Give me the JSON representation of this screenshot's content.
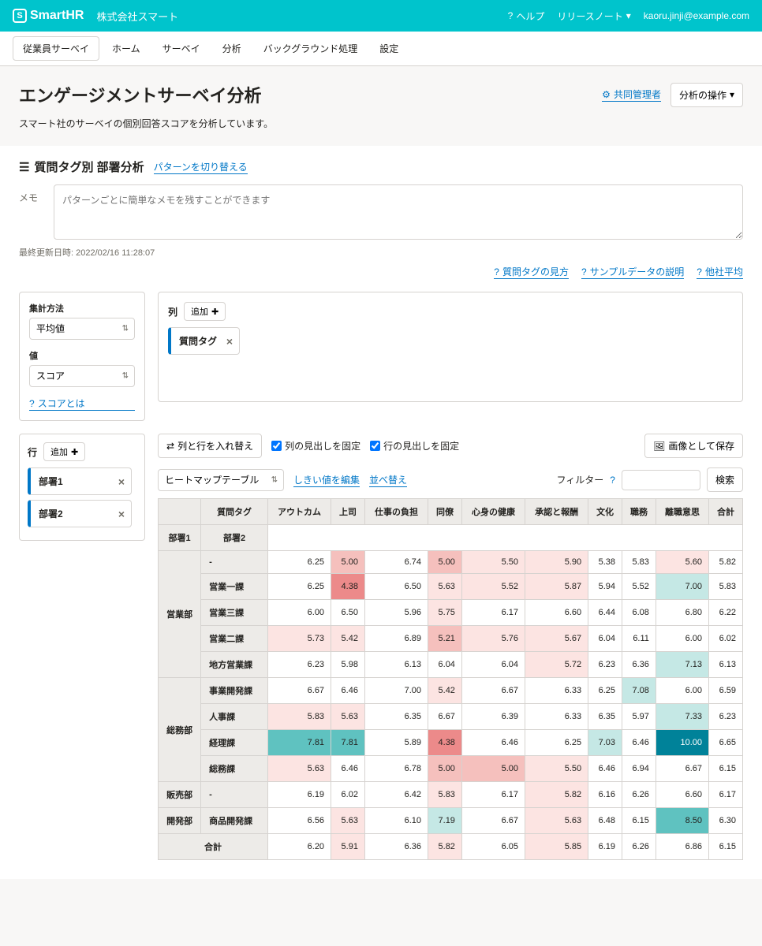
{
  "header": {
    "brand": "SmartHR",
    "company": "株式会社スマート",
    "help": "ヘルプ",
    "release": "リリースノート",
    "user": "kaoru.jinji@example.com"
  },
  "nav": {
    "items": [
      "従業員サーベイ",
      "ホーム",
      "サーベイ",
      "分析",
      "バックグラウンド処理",
      "設定"
    ]
  },
  "page": {
    "title": "エンゲージメントサーベイ分析",
    "desc": "スマート社のサーベイの個別回答スコアを分析しています。",
    "share": "共同管理者",
    "actions": "分析の操作"
  },
  "section": {
    "title": "質問タグ別 部署分析",
    "switch": "パターンを切り替える",
    "memo_label": "メモ",
    "memo_placeholder": "パターンごとに簡単なメモを残すことができます",
    "updated": "最終更新日時: 2022/02/16 11:28:07",
    "help1": "質問タグの見方",
    "help2": "サンプルデータの説明",
    "help3": "他社平均"
  },
  "settings": {
    "agg_label": "集計方法",
    "agg_value": "平均値",
    "val_label": "値",
    "val_value": "スコア",
    "score_link": "スコアとは",
    "col_label": "列",
    "add": "追加",
    "col_chip": "質問タグ",
    "row_label": "行",
    "row_chip1": "部署1",
    "row_chip2": "部署2"
  },
  "toolbar": {
    "swap": "列と行を入れ替え",
    "fix_col": "列の見出しを固定",
    "fix_row": "行の見出しを固定",
    "save_img": "画像として保存",
    "table_type": "ヒートマップテーブル",
    "threshold": "しきい値を編集",
    "sort": "並べ替え",
    "filter": "フィルター",
    "search": "検索"
  },
  "table": {
    "tag_header": "質問タグ",
    "dept1": "部署1",
    "dept2": "部署2",
    "cols": [
      "アウトカム",
      "上司",
      "仕事の負担",
      "同僚",
      "心身の健康",
      "承認と報酬",
      "文化",
      "職務",
      "離職意思",
      "合計"
    ],
    "groups": [
      {
        "dept": "営業部",
        "rows": [
          {
            "sub": "-",
            "v": [
              "6.25",
              "5.00",
              "6.74",
              "5.00",
              "5.50",
              "5.90",
              "5.38",
              "5.83",
              "5.60",
              "5.82"
            ],
            "cls": [
              "",
              "c-pink-m",
              "",
              "c-pink-m",
              "c-pink-l",
              "c-pink-l",
              "",
              "",
              "c-pink-l",
              ""
            ]
          },
          {
            "sub": "営業一課",
            "v": [
              "6.25",
              "4.38",
              "6.50",
              "5.63",
              "5.52",
              "5.87",
              "5.94",
              "5.52",
              "7.00",
              "5.83"
            ],
            "cls": [
              "",
              "c-pink-d",
              "",
              "c-pink-l",
              "c-pink-l",
              "c-pink-l",
              "",
              "",
              "c-teal-l",
              ""
            ]
          },
          {
            "sub": "営業三課",
            "v": [
              "6.00",
              "6.50",
              "5.96",
              "5.75",
              "6.17",
              "6.60",
              "6.44",
              "6.08",
              "6.80",
              "6.22"
            ],
            "cls": [
              "",
              "",
              "",
              "c-pink-l",
              "",
              "",
              "",
              "",
              "",
              ""
            ]
          },
          {
            "sub": "営業二課",
            "v": [
              "5.73",
              "5.42",
              "6.89",
              "5.21",
              "5.76",
              "5.67",
              "6.04",
              "6.11",
              "6.00",
              "6.02"
            ],
            "cls": [
              "c-pink-l",
              "c-pink-l",
              "",
              "c-pink-m",
              "c-pink-l",
              "c-pink-l",
              "",
              "",
              "",
              ""
            ]
          },
          {
            "sub": "地方営業課",
            "v": [
              "6.23",
              "5.98",
              "6.13",
              "6.04",
              "6.04",
              "5.72",
              "6.23",
              "6.36",
              "7.13",
              "6.13"
            ],
            "cls": [
              "",
              "",
              "",
              "",
              "",
              "c-pink-l",
              "",
              "",
              "c-teal-l",
              ""
            ]
          }
        ]
      },
      {
        "dept": "総務部",
        "rows": [
          {
            "sub": "事業開発課",
            "v": [
              "6.67",
              "6.46",
              "7.00",
              "5.42",
              "6.67",
              "6.33",
              "6.25",
              "7.08",
              "6.00",
              "6.59"
            ],
            "cls": [
              "",
              "",
              "",
              "c-pink-l",
              "",
              "",
              "",
              "c-teal-l",
              "",
              ""
            ]
          },
          {
            "sub": "人事課",
            "v": [
              "5.83",
              "5.63",
              "6.35",
              "6.67",
              "6.39",
              "6.33",
              "6.35",
              "5.97",
              "7.33",
              "6.23"
            ],
            "cls": [
              "c-pink-l",
              "c-pink-l",
              "",
              "",
              "",
              "",
              "",
              "",
              "c-teal-l",
              ""
            ]
          },
          {
            "sub": "経理課",
            "v": [
              "7.81",
              "7.81",
              "5.89",
              "4.38",
              "6.46",
              "6.25",
              "7.03",
              "6.46",
              "10.00",
              "6.65"
            ],
            "cls": [
              "c-teal-m",
              "c-teal-m",
              "",
              "c-pink-d",
              "",
              "",
              "c-teal-l",
              "",
              "c-teal-d",
              ""
            ]
          },
          {
            "sub": "総務課",
            "v": [
              "5.63",
              "6.46",
              "6.78",
              "5.00",
              "5.00",
              "5.50",
              "6.46",
              "6.94",
              "6.67",
              "6.15"
            ],
            "cls": [
              "c-pink-l",
              "",
              "",
              "c-pink-m",
              "c-pink-m",
              "c-pink-l",
              "",
              "",
              "",
              ""
            ]
          }
        ]
      },
      {
        "dept": "販売部",
        "rows": [
          {
            "sub": "-",
            "v": [
              "6.19",
              "6.02",
              "6.42",
              "5.83",
              "6.17",
              "5.82",
              "6.16",
              "6.26",
              "6.60",
              "6.17"
            ],
            "cls": [
              "",
              "",
              "",
              "c-pink-l",
              "",
              "c-pink-l",
              "",
              "",
              "",
              ""
            ]
          }
        ]
      },
      {
        "dept": "開発部",
        "rows": [
          {
            "sub": "商品開発課",
            "v": [
              "6.56",
              "5.63",
              "6.10",
              "7.19",
              "6.67",
              "5.63",
              "6.48",
              "6.15",
              "8.50",
              "6.30"
            ],
            "cls": [
              "",
              "c-pink-l",
              "",
              "c-teal-l",
              "",
              "c-pink-l",
              "",
              "",
              "c-teal-m",
              ""
            ]
          }
        ]
      }
    ],
    "total_label": "合計",
    "total": [
      "6.20",
      "5.91",
      "6.36",
      "5.82",
      "6.05",
      "5.85",
      "6.19",
      "6.26",
      "6.86",
      "6.15"
    ],
    "total_cls": [
      "",
      "c-pink-l",
      "",
      "c-pink-l",
      "",
      "c-pink-l",
      "",
      "",
      "",
      ""
    ]
  }
}
